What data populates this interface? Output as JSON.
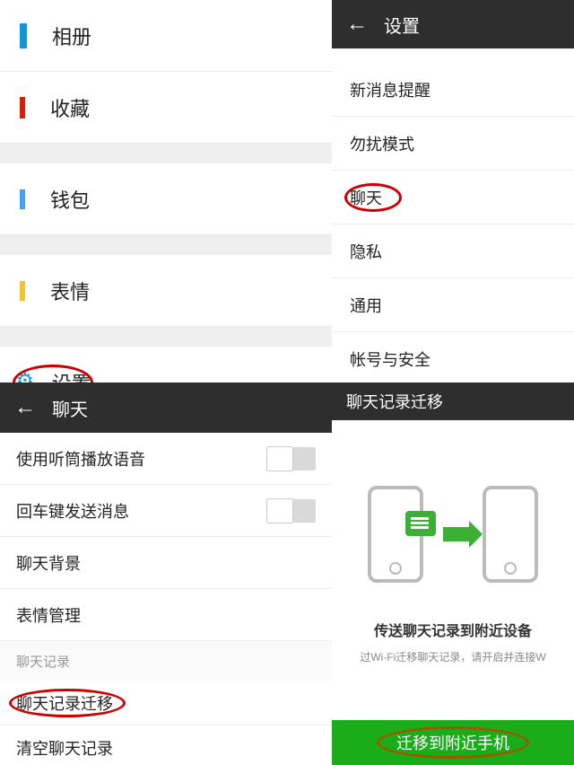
{
  "panel1": {
    "items": [
      {
        "label": "相册"
      },
      {
        "label": "收藏"
      },
      {
        "label": "钱包"
      },
      {
        "label": "表情"
      },
      {
        "label": "设置"
      }
    ]
  },
  "panel2": {
    "title": "设置",
    "items": [
      {
        "label": "新消息提醒"
      },
      {
        "label": "勿扰模式"
      },
      {
        "label": "聊天"
      },
      {
        "label": "隐私"
      },
      {
        "label": "通用"
      },
      {
        "label": "帐号与安全"
      }
    ]
  },
  "panel3": {
    "title": "聊天",
    "items": [
      {
        "label": "使用听筒播放语音"
      },
      {
        "label": "回车键发送消息"
      },
      {
        "label": "聊天背景"
      },
      {
        "label": "表情管理"
      }
    ],
    "section_label": "聊天记录",
    "items2": [
      {
        "label": "聊天记录迁移"
      },
      {
        "label": "清空聊天记录"
      }
    ]
  },
  "panel4": {
    "title": "聊天记录迁移",
    "heading": "传送聊天记录到附近设备",
    "subtext": "过Wi-Fi迁移聊天记录，请开启并连接W",
    "button": "迁移到附近手机"
  }
}
